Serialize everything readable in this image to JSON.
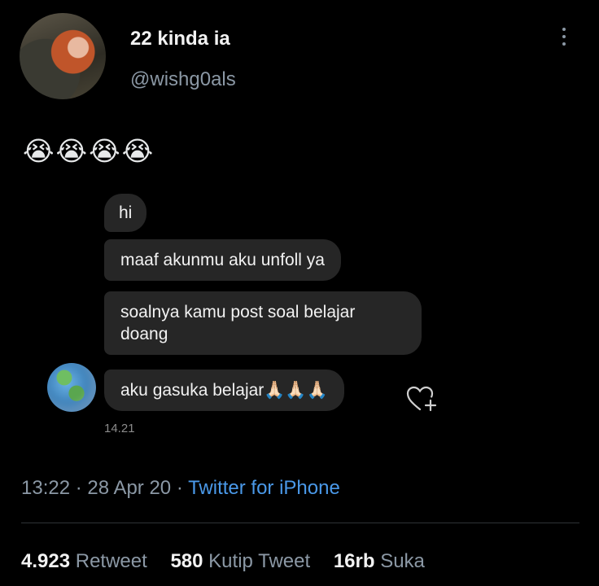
{
  "tweet": {
    "display_name": "22 kinda ia",
    "handle": "@wishg0als",
    "emojis": "😭😭😭😭"
  },
  "chat": {
    "messages": [
      "hi",
      "maaf akunmu aku unfoll ya",
      "soalnya kamu post soal belajar doang",
      "aku gasuka belajar🙏🏻🙏🏻🙏🏻"
    ],
    "timestamp": "14.21"
  },
  "meta": {
    "time": "13:22",
    "sep1": "·",
    "date": "28 Apr 20",
    "sep2": "·",
    "source": "Twitter for iPhone"
  },
  "stats": {
    "retweets_count": "4.923",
    "retweets_label": "Retweet",
    "quotes_count": "580",
    "quotes_label": "Kutip Tweet",
    "likes_count": "16rb",
    "likes_label": "Suka"
  },
  "icons": {
    "more": "vertical-ellipsis",
    "react": "heart-plus"
  },
  "colors": {
    "background": "#000000",
    "bubble": "#262626",
    "link": "#4a99e9",
    "secondary_text": "#8b98a5"
  }
}
